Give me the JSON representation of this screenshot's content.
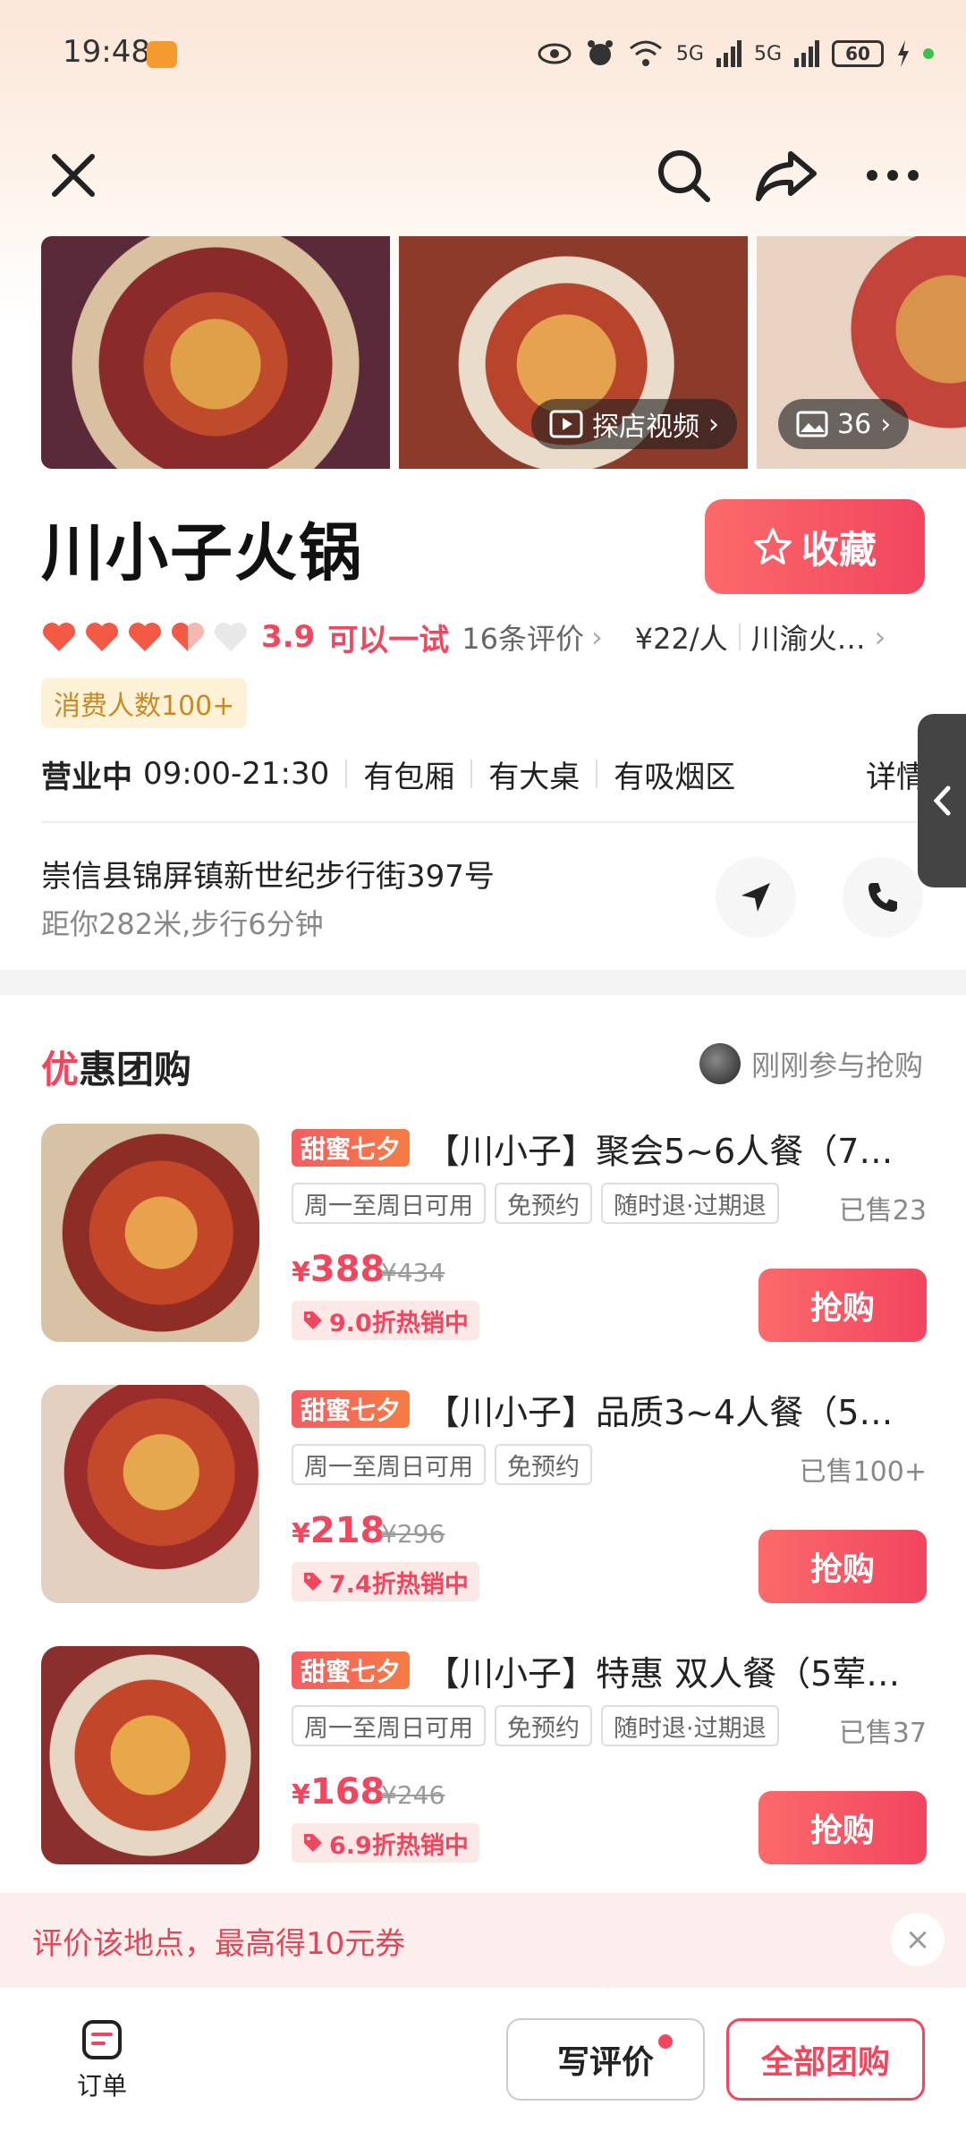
{
  "status_bar": {
    "time": "19:48",
    "network": "5G",
    "network2": "5G",
    "battery": "60"
  },
  "header": {
    "close_icon": "close-icon",
    "search_icon": "search-icon",
    "share_icon": "share-icon",
    "more_icon": "more-icon"
  },
  "gallery": {
    "video_label": "探店视频",
    "photo_count": "36"
  },
  "shop": {
    "name": "川小子火锅",
    "favorite_label": "收藏",
    "rating": "3.9",
    "rating_text": "可以一试",
    "review_count": "16条评价",
    "avg_price": "¥22/人",
    "category": "川渝火…",
    "consume_tag": "消费人数100+",
    "open_status": "营业中",
    "hours": "09:00-21:30",
    "features": [
      "有包厢",
      "有大桌",
      "有吸烟区"
    ],
    "details_label": "详情",
    "address": "崇信县锦屏镇新世纪步行街397号",
    "distance": "距你282米,步行6分钟"
  },
  "deals_section": {
    "title_first": "优",
    "title_rest": "惠团购",
    "recent_text": "刚刚参与抢购",
    "items": [
      {
        "tag": "甜蜜七夕",
        "name": "【川小子】聚会5~6人餐（7…",
        "props": [
          "周一至周日可用",
          "免预约",
          "随时退·过期退"
        ],
        "sold": "已售23",
        "price": "388",
        "orig": "¥434",
        "discount": "9.0折热销中",
        "buy": "抢购"
      },
      {
        "tag": "甜蜜七夕",
        "name": "【川小子】品质3~4人餐（5…",
        "props": [
          "周一至周日可用",
          "免预约"
        ],
        "sold": "已售100+",
        "price": "218",
        "orig": "¥296",
        "discount": "7.4折热销中",
        "buy": "抢购"
      },
      {
        "tag": "甜蜜七夕",
        "name": "【川小子】特惠 双人餐（5荤…",
        "props": [
          "周一至周日可用",
          "免预约",
          "随时退·过期退"
        ],
        "sold": "已售37",
        "price": "168",
        "orig": "¥246",
        "discount": "6.9折热销中",
        "buy": "抢购"
      }
    ],
    "currency": "¥"
  },
  "review_banner": {
    "text": "评价该地点，最高得10元券"
  },
  "bottom_bar": {
    "order_label": "订单",
    "write_review": "写评价",
    "all_deals": "全部团购"
  },
  "colors": {
    "accent": "#f0465e",
    "tag_gold": "#c78a24"
  }
}
